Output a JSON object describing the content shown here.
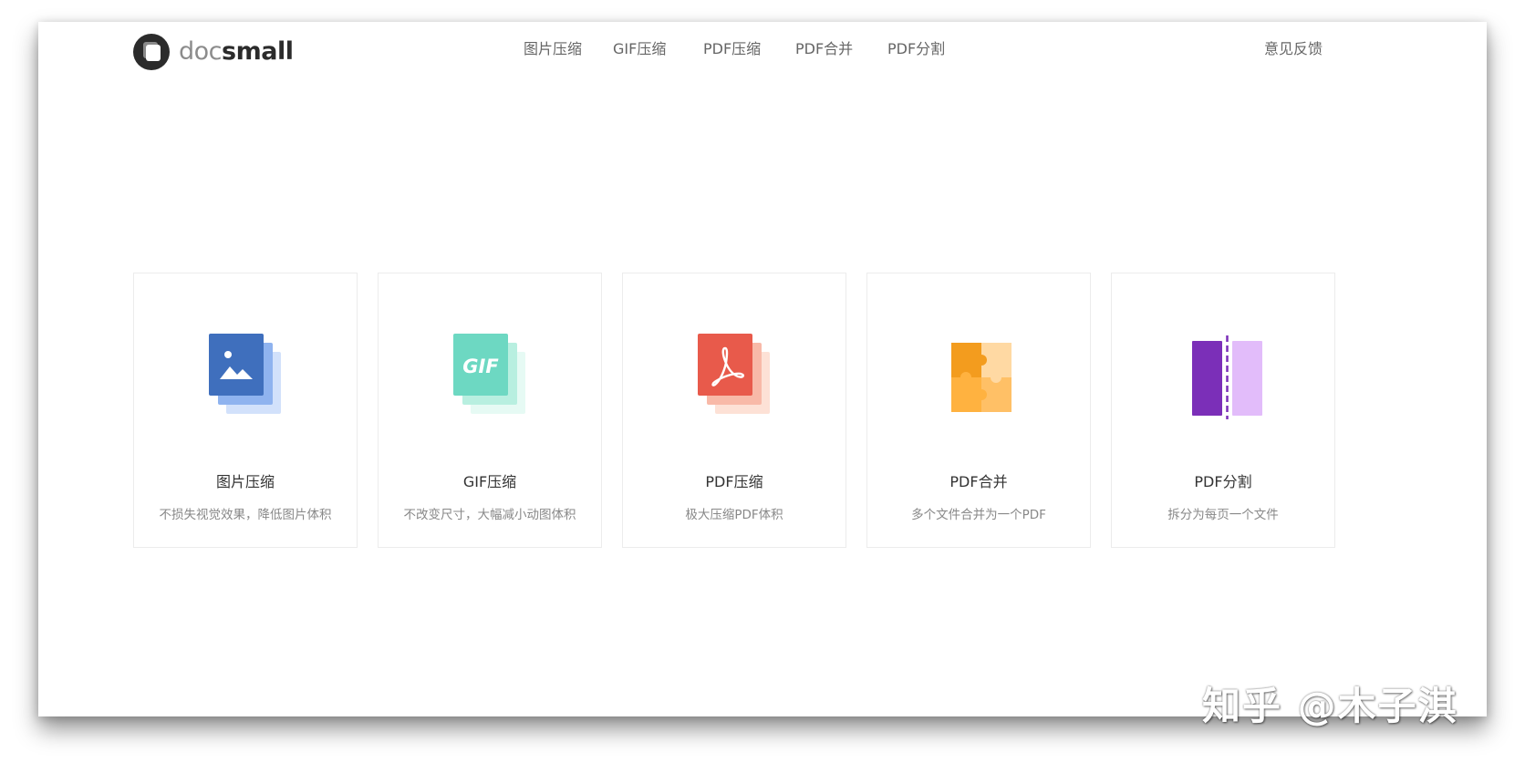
{
  "header": {
    "logo": {
      "text_part1": "doc",
      "text_part2": "small"
    },
    "nav": [
      {
        "label": "图片压缩"
      },
      {
        "label": "GIF压缩"
      },
      {
        "label": "PDF压缩"
      },
      {
        "label": "PDF合并"
      },
      {
        "label": "PDF分割"
      }
    ],
    "feedback_label": "意见反馈"
  },
  "cards": [
    {
      "title": "图片压缩",
      "desc": "不损失视觉效果，降低图片体积",
      "icon": "image-compress-icon",
      "color": "#3f6fbd"
    },
    {
      "title": "GIF压缩",
      "desc": "不改变尺寸，大幅减小动图体积",
      "icon": "gif-compress-icon",
      "color": "#6dd8c2",
      "icon_text": "GIF"
    },
    {
      "title": "PDF压缩",
      "desc": "极大压缩PDF体积",
      "icon": "pdf-compress-icon",
      "color": "#e85a4b"
    },
    {
      "title": "PDF合并",
      "desc": "多个文件合并为一个PDF",
      "icon": "pdf-merge-icon",
      "color": "#f39c1e"
    },
    {
      "title": "PDF分割",
      "desc": "拆分为每页一个文件",
      "icon": "pdf-split-icon",
      "color": "#7b2fb8"
    }
  ],
  "watermark": "知乎 @木子淇"
}
